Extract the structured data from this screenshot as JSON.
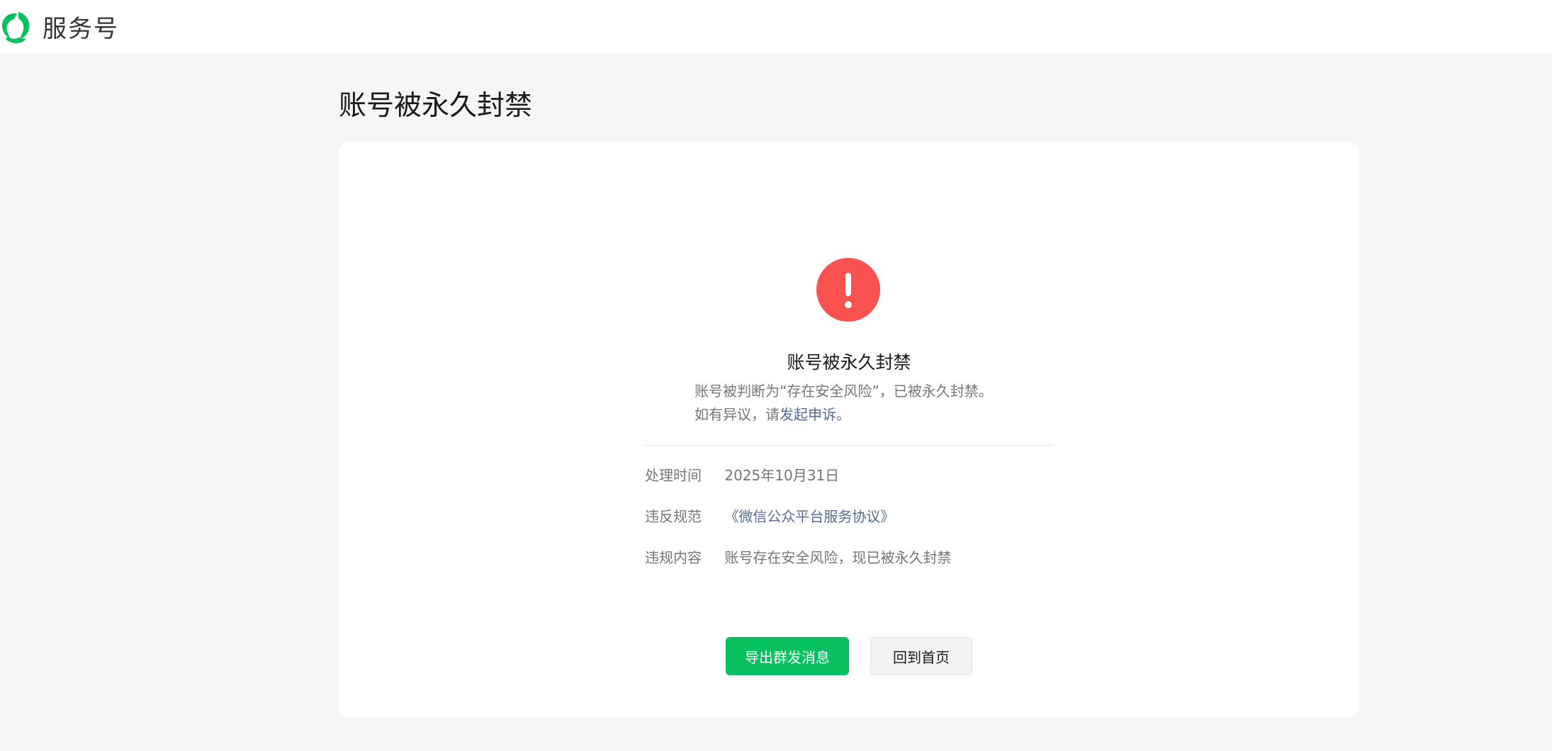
{
  "header": {
    "logo_icon": "wechat-service-logo-icon",
    "app_name": "服务号",
    "brand_color": "#07c160"
  },
  "page": {
    "title": "账号被永久封禁"
  },
  "status": {
    "icon": "exclamation-circle-icon",
    "icon_color": "#fa5151",
    "title": "账号被永久封禁",
    "desc_line1": "账号被判断为“存在安全风险”，已被永久封禁。",
    "desc_line2_prefix": "如有异议，请",
    "appeal_link": "发起申诉",
    "desc_line2_suffix": "。"
  },
  "details": {
    "time_label": "处理时间",
    "time_value": "2025年10月31日",
    "rule_label": "违反规范",
    "rule_value": "《微信公众平台服务协议》",
    "content_label": "违规内容",
    "content_value": "账号存在安全风险，现已被永久封禁"
  },
  "actions": {
    "export_label": "导出群发消息",
    "home_label": "回到首页"
  }
}
